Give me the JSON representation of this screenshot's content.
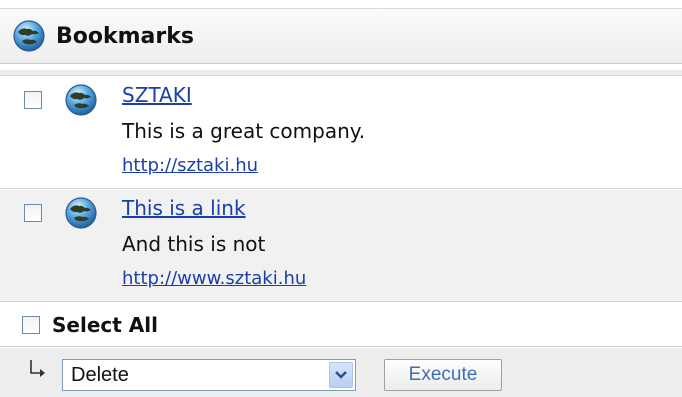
{
  "header": {
    "title": "Bookmarks",
    "icon": "globe-icon"
  },
  "bookmarks": [
    {
      "title": "SZTAKI",
      "description": "This is a great company.",
      "url": "http://sztaki.hu",
      "checked": false
    },
    {
      "title": "This is a link",
      "description": "And this is not",
      "url": "http://www.sztaki.hu",
      "checked": false
    }
  ],
  "select_all": {
    "label": "Select All",
    "checked": false
  },
  "footer": {
    "action_select": {
      "value": "Delete"
    },
    "execute_label": "Execute"
  },
  "colors": {
    "link": "#1a3fa8",
    "header_bg": "#eeeeee",
    "alt_row_bg": "#f1f1f1",
    "execute_text": "#3a6fb4"
  }
}
